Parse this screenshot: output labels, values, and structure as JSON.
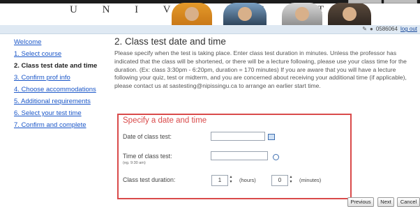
{
  "header": {
    "university_text": "U N I V E R S I T Y"
  },
  "userbar": {
    "user_id": "0586064",
    "logout_label": "log out"
  },
  "sidebar": {
    "items": [
      {
        "label": "Welcome",
        "state": "link"
      },
      {
        "label": "1. Select course",
        "state": "link"
      },
      {
        "label": "2. Class test date and time",
        "state": "current"
      },
      {
        "label": "3. Confirm prof info",
        "state": "link"
      },
      {
        "label": "4. Choose accommodations",
        "state": "link"
      },
      {
        "label": "5. Additional requirements",
        "state": "link"
      },
      {
        "label": "6. Select your test time",
        "state": "link"
      },
      {
        "label": "7. Confirm and complete",
        "state": "link"
      }
    ]
  },
  "main": {
    "title": "2. Class test date and time",
    "intro": "Please specify when the test is taking place. Enter class test duration in minutes. Unless the professor has indicated that the class will be shortened, or there will be a lecture following, please use your class time for the duration. (Ex: class 3:30pm - 6:20pm, duration = 170 minutes) If you are aware that you will have a lecture following your quiz, test or midterm, and you are concerned about receiving your additional time (if applicable), please contact us at sastesting@nipissingu.ca to arrange an earlier start time."
  },
  "form": {
    "section_title": "Specify a date and time",
    "date_label": "Date of class test:",
    "date_value": "",
    "time_label": "Time of class test:",
    "time_hint": "(eg. 9:30 am)",
    "time_value": "",
    "duration_label": "Class test duration:",
    "hours_value": "1",
    "hours_unit": "(hours)",
    "minutes_value": "0",
    "minutes_unit": "(minutes)"
  },
  "buttons": {
    "previous": "Previous",
    "next": "Next",
    "cancel": "Cancel"
  },
  "colors": {
    "accent_red": "#d94a4a",
    "link_blue": "#1a56c8"
  }
}
